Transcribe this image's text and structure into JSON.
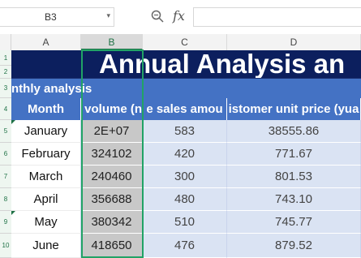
{
  "formula_bar": {
    "name_box": "B3",
    "formula": ""
  },
  "icons": {
    "zoom": "zoom-icon",
    "function": "fx-icon",
    "caret": "chevron-down-icon"
  },
  "fx_label": "fx",
  "columns": [
    "A",
    "B",
    "C",
    "D"
  ],
  "rows": [
    "1",
    "2",
    "3",
    "4",
    "5",
    "6",
    "7",
    "8",
    "9",
    "10"
  ],
  "sheet": {
    "title": "Annual Analysis an",
    "subtitle": "nthly analysis",
    "headers": [
      "Month",
      "s volume (ne",
      "e sales amou",
      "istomer unit price (yua"
    ],
    "data": [
      [
        "January",
        "2E+07",
        "583",
        "38555.86"
      ],
      [
        "February",
        "324102",
        "420",
        "771.67"
      ],
      [
        "March",
        "240460",
        "300",
        "801.53"
      ],
      [
        "April",
        "356688",
        "480",
        "743.10"
      ],
      [
        "May",
        "380342",
        "510",
        "745.77"
      ],
      [
        "June",
        "418650",
        "476",
        "879.52"
      ]
    ]
  },
  "colors": {
    "title_bg": "#0c1f5e",
    "header_bg": "#4472c4",
    "selection": "#21a366"
  }
}
